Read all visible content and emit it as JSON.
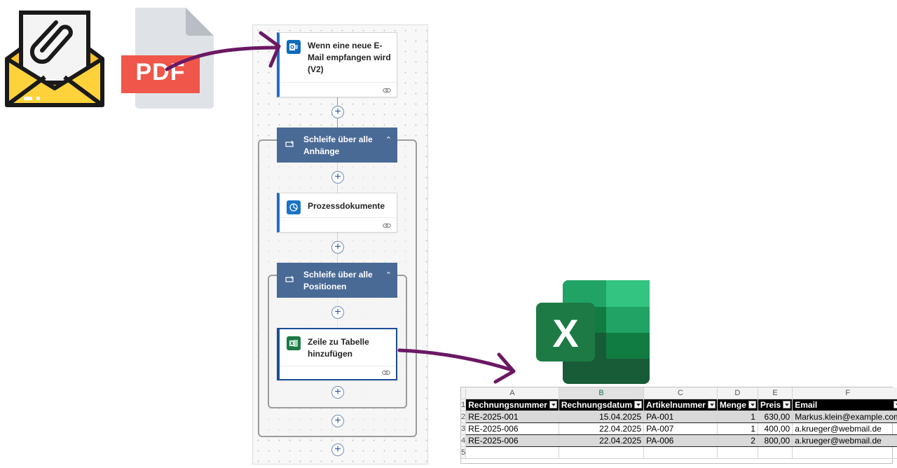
{
  "pdf_label": "PDF",
  "excel_letter": "X",
  "colors": {
    "arrow": "#6b1863",
    "scope": "#4a6a96",
    "card_accent": "#1f6fc5",
    "excel_green": "#1e7a45",
    "pdf_red": "#f0564a"
  },
  "flow": {
    "trigger": {
      "title": "Wenn eine neue E-Mail empfangen wird (V2)",
      "icon": "outlook-icon"
    },
    "loop_attachments": {
      "title": "Schleife über alle Anhänge",
      "icon": "loop-icon"
    },
    "process_documents": {
      "title": "Prozessdokumente",
      "icon": "ai-builder-icon"
    },
    "loop_positions": {
      "title": "Schleife über alle Positionen",
      "icon": "loop-icon"
    },
    "add_row": {
      "title": "Zeile zu Tabelle hinzufügen",
      "icon": "excel-icon"
    },
    "add_step_label": "+"
  },
  "sheet": {
    "column_letters": [
      "A",
      "B",
      "C",
      "D",
      "E",
      "F"
    ],
    "row_numbers": [
      "1",
      "2",
      "3",
      "4",
      "5"
    ],
    "headers": [
      "Rechnungsnummer",
      "Rechnungsdatum",
      "Artikelnummer",
      "Menge",
      "Preis",
      "Email"
    ],
    "rows": [
      [
        "RE-2025-001",
        "15.04.2025",
        "PA-001",
        "1",
        "630,00",
        "Markus.klein@example.com"
      ],
      [
        "RE-2025-006",
        "22.04.2025",
        "PA-007",
        "1",
        "400,00",
        "a.krueger@webmail.de"
      ],
      [
        "RE-2025-006",
        "22.04.2025",
        "PA-006",
        "2",
        "800,00",
        "a.krueger@webmail.de"
      ]
    ]
  }
}
